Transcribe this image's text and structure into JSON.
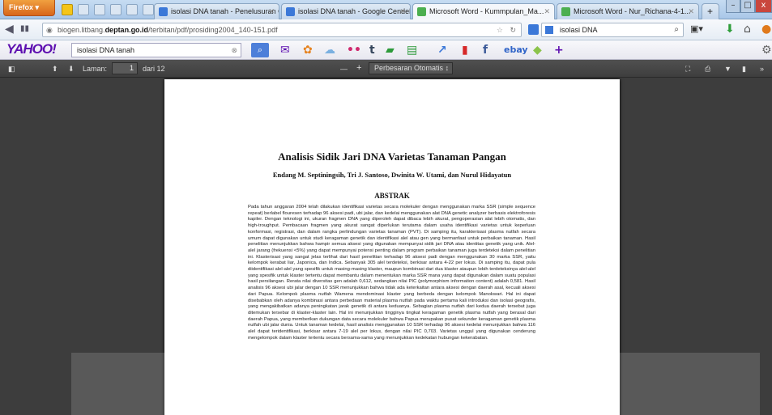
{
  "browser": {
    "menu_button": "Firefox",
    "tabs": [
      {
        "label": "isolasi DNA tanah - Penelusuran G...",
        "favicon_color": "#3b78d8",
        "active": false
      },
      {
        "label": "isolasi DNA tanah - Google Cendekia",
        "favicon_color": "#3b78d8",
        "active": false
      },
      {
        "label": "Microsoft Word - Kummpulan_Ma...",
        "favicon_color": "#4caf50",
        "active": true
      },
      {
        "label": "Microsoft Word - Nur_Richana-4-1...",
        "favicon_color": "#4caf50",
        "active": false
      }
    ],
    "new_tab": "+",
    "url_prefix": "biogen.litbang.",
    "url_domain": "deptan.go.id",
    "url_path": "/terbitan/pdf/prosiding2004_140-151.pdf",
    "search_value": "isolasi DNA",
    "window_controls": [
      "–",
      "□",
      "x"
    ]
  },
  "yahoo": {
    "logo": "YAHOO!",
    "search_value": "isolasi DNA tanah",
    "brand_color": "#5e0fb0",
    "toolbar_icons": [
      "mail-icon",
      "flower-icon",
      "weather-icon",
      "flickr-icon",
      "tumblr-icon",
      "chat-icon",
      "news-icon",
      "finance-icon",
      "bookmark-icon",
      "facebook-icon",
      "ebay-icon",
      "tag-icon",
      "add-icon"
    ],
    "ebay_label": "ebay"
  },
  "pdf": {
    "page_label": "Laman:",
    "page_value": "1",
    "page_of": "dari 12",
    "zoom_minus": "—",
    "zoom_plus": "+",
    "zoom_value": "Perbesaran Otomatis"
  },
  "document": {
    "title": "Analisis Sidik Jari DNA Varietas Tanaman Pangan",
    "authors": "Endang M. Septiningsih, Tri J. Santoso, Dwinita W. Utami, dan Nurul Hidayatun",
    "abstract_heading": "ABSTRAK",
    "abstract_body": "Pada tahun anggaran 2004 telah dilakukan identifikasi varietas secara molekuler dengan menggunakan marka SSR (simple sequence repeat) berlabel flouresen terhadap 96 aksesi padi, ubi jalar, dan kedelai menggunakan alat DNA genetic analyzer berbasis elektroforesis kapiler. Dengan teknologi ini, ukuran fragmen DNA yang diperoleh dapat dibaca lebih akurat, pengoperasian alat lebih otomatis, dan high-troughput. Pembacaan fragmen yang akurat sangat diperlukan terutama dalam usaha identifikasi varietas untuk keperluan konformasi, registrasi, dan dalam rangka perlindungan varietas tanaman (PVT). Di samping itu, karakterisasi plasma nutfah secara umum dapat digunakan untuk studi keragaman genetik dan identifikasi alel atau gen yang bermanfaat untuk perbaikan tanaman. Hasil penelitian menunjukkan bahwa hampir semua aksesi yang digunakan mempunyai sidik jari DNA atau identitas genetik yang unik. Alel-alel jarang (frekuensi <5%) yang dapat mempunyai potensi penting dalam program perbaikan tanaman juga terdeteksi dalam penelitian ini. Klasterisasi yang sangat jelas terlihat dari hasil penelitian terhadap 96 aksesi padi dengan menggunakan 30 marka SSR, yaitu kelompok kerabat liar, Japonica, dan Indica. Sebanyak 305 alel terdeteksi, berkisar antara 4-22 per lokus. Di samping itu, dapat pula diidentifikasi alel-alel yang spesifik untuk masing-masing klaster, maupun kombinasi dari dua klaster ataupun lebih terdeteksinya alel-alel yang spesifik untuk klaster tertentu dapat membantu dalam menentukan marka SSR mana yang dapat digunakan dalam suatu populasi hasil persilangan. Rerata nilai diversitas gen adalah 0,612, sedangkan nilai PIC (polymorphism information content) adalah 0,581. Hasil analisis 96 aksesi ubi jalar dengan 10 SSR menunjukkan bahwa tidak ada keterkaitan antara aksesi dengan daerah asal, kecuali aksesi dari Papua. Kelompok plasma nutfah Wamena mendominasi klaster yang berbeda dengan kelompok Manokwari. Hal ini dapat disebabkan oleh adanya kombinasi antara perbedaan material plasma nutfah pada waktu pertama kali introduksi dan isolasi geografis, yang mengakibatkan adanya peningkatan jarak genetik di antara keduanya. Sebagian plasma nutfah dari kedua daerah tersebut juga ditemukan tersebar di klaster-klaster lain. Hal ini menunjukkan tingginya tingkat keragaman genetik plasma nutfah yang berasal dari daerah Papua, yang memberikan dukungan data secara molekuler bahwa Papua merupakan pusat sekunder keragaman genetik plasma nutfah ubi jalar dunia. Untuk tanaman kedelai, hasil analisis menggunakan 10 SSR terhadap 96 aksesi kedelai menunjukkan bahwa 116 alel dapat teridentifikasi, berkisar antara 7-19 alel per lokus, dengan nilai PIC 0,703. Varietas unggul yang digunakan cenderung mengelompok dalam klaster tertentu secara bersama-sama yang menunjukkan kedekatan hubungan kekerabatan."
  }
}
